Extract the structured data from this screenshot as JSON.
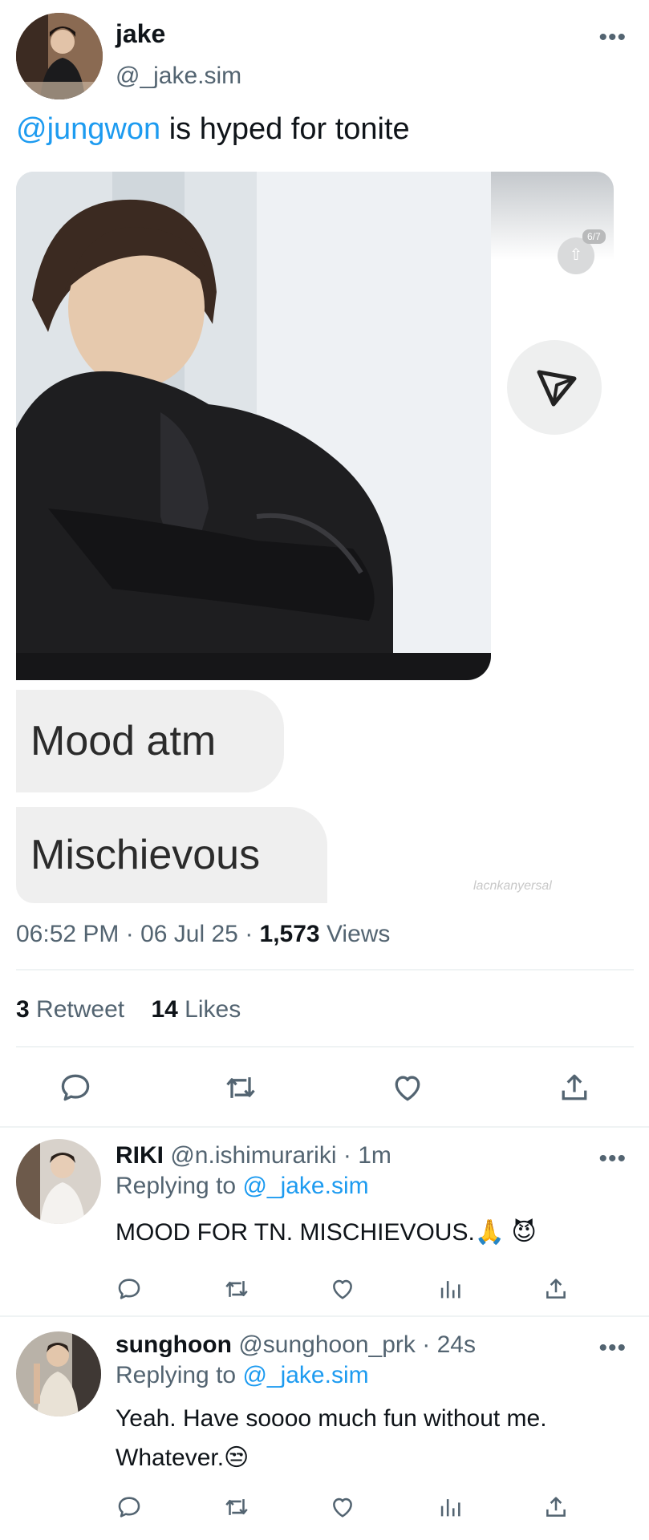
{
  "tweet": {
    "author_name": "jake",
    "author_handle": "@_jake.sim",
    "mention": "@jungwon",
    "text_rest": " is hyped for tonite",
    "media": {
      "counter": "6/7",
      "bubble_1": "Mood atm",
      "bubble_2": "Mischievous",
      "watermark": "lacnkanyersal"
    },
    "time": "06:52 PM",
    "date": "06 Jul 25",
    "views_count": "1,573",
    "views_label": "Views",
    "retweet_count": "3",
    "retweet_label": "Retweet",
    "likes_count": "14",
    "likes_label": "Likes",
    "actions": [
      "reply-icon",
      "retweet-icon",
      "like-icon",
      "share-icon"
    ]
  },
  "replies": [
    {
      "name": "RIKI",
      "handle": "@n.ishimurariki",
      "time": "1m",
      "replying_label": "Replying to",
      "replying_to": "@_jake.sim",
      "text": "MOOD FOR TN. MISCHIEVOUS.🙏 😈",
      "actions": [
        "reply-icon",
        "retweet-icon",
        "like-icon",
        "analytics-icon",
        "share-icon"
      ]
    },
    {
      "name": "sunghoon",
      "handle": "@sunghoon_prk",
      "time": "24s",
      "replying_label": "Replying to",
      "replying_to": "@_jake.sim",
      "text_line1": "Yeah. Have soooo much fun without me.",
      "text_line2": "Whatever.😒",
      "actions": [
        "reply-icon",
        "retweet-icon",
        "like-icon",
        "analytics-icon",
        "share-icon"
      ]
    }
  ],
  "colors": {
    "accent": "#1d9bf0",
    "text_primary": "#0f1419",
    "text_secondary": "#536471",
    "divider": "#eff3f4"
  }
}
